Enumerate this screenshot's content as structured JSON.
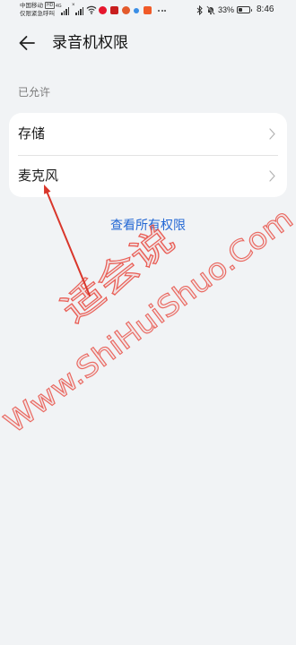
{
  "status_bar": {
    "carrier": "中国移动",
    "carrier_badge": "HD",
    "carrier_status": "仅限紧急呼叫",
    "network": "4G",
    "battery_percent": "33%",
    "battery_level": 0.33,
    "time": "8:46",
    "icons": [
      "signal-sim1-icon",
      "signal-sim2-no-service-icon",
      "wifi-icon",
      "weibo-notification-icon",
      "app-notification-icon",
      "app-notification-icon",
      "app-notification-icon",
      "app-notification-icon",
      "more-notifications-icon",
      "bluetooth-icon",
      "mute-bell-icon",
      "battery-icon"
    ]
  },
  "header": {
    "back_icon": "arrow-left-icon",
    "title": "录音机权限"
  },
  "section": {
    "label": "已允许"
  },
  "permissions": [
    {
      "label": "存储",
      "icon": "chevron-right-icon"
    },
    {
      "label": "麦克风",
      "icon": "chevron-right-icon"
    }
  ],
  "link": {
    "label": "查看所有权限"
  },
  "watermark": {
    "brand": "适会说",
    "url": "Www.ShiHuiShuo.Com"
  },
  "colors": {
    "background": "#f1f3f5",
    "card": "#ffffff",
    "link": "#2468d4",
    "watermark": "#e8463c",
    "annotation": "#d9362b"
  }
}
